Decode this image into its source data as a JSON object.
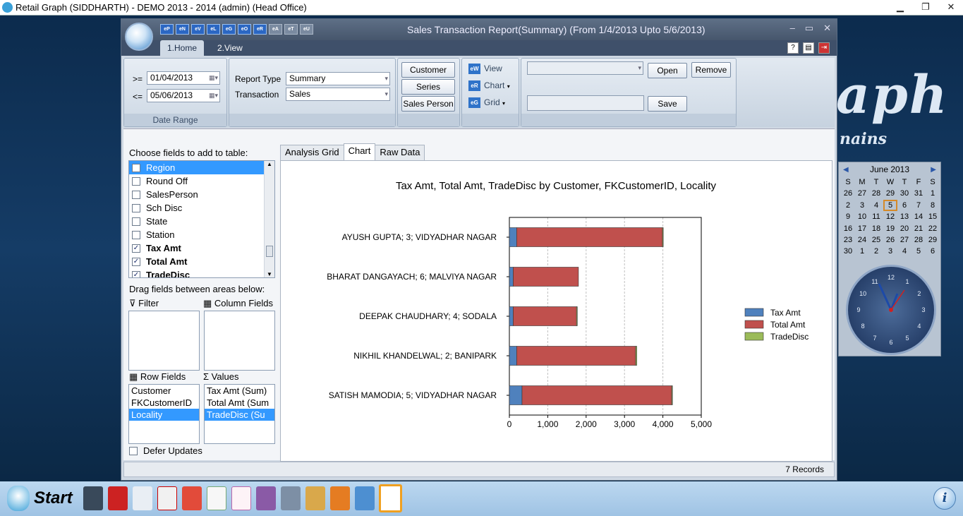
{
  "window": {
    "title": "Retail Graph (SIDDHARTH) - DEMO  2013 - 2014 (admin) (Head Office)"
  },
  "app": {
    "title": "Sales Transaction Report(Summary) (From 1/4/2013 Upto 5/6/2013)",
    "qat_icons": [
      "eP",
      "eN",
      "eV",
      "eL",
      "eG",
      "eO",
      "eR",
      "eA",
      "eT",
      "eU"
    ],
    "tabs": [
      {
        "label": "1.Home"
      },
      {
        "label": "2.View"
      }
    ]
  },
  "ribbon": {
    "date": {
      "from_label": ">=",
      "from_value": "01/04/2013",
      "to_label": "<=",
      "to_value": "05/06/2013",
      "caption": "Date Range"
    },
    "report": {
      "type_label": "Report Type",
      "type_value": "Summary",
      "transaction_label": "Transaction",
      "transaction_value": "Sales"
    },
    "buttons": {
      "customer": "Customer",
      "series": "Series",
      "sales_person": "Sales Person"
    },
    "view": {
      "view": "View",
      "chart": "Chart",
      "grid": "Grid"
    },
    "layout": {
      "open": "Open",
      "remove": "Remove",
      "save": "Save"
    }
  },
  "fields": {
    "title": "Choose fields to add to table:",
    "items": [
      {
        "label": "Region",
        "checked": false,
        "selected": true
      },
      {
        "label": "Round Off",
        "checked": false
      },
      {
        "label": "SalesPerson",
        "checked": false
      },
      {
        "label": "Sch Disc",
        "checked": false
      },
      {
        "label": "State",
        "checked": false
      },
      {
        "label": "Station",
        "checked": false
      },
      {
        "label": "Tax Amt",
        "checked": true
      },
      {
        "label": "Total Amt",
        "checked": true
      },
      {
        "label": "TradeDisc",
        "checked": true
      }
    ],
    "drag_title": "Drag fields between areas below:",
    "filter_label": "Filter",
    "column_label": "Column Fields",
    "row_label": "Row Fields",
    "values_label": "Values",
    "row_fields": [
      "Customer",
      "FKCustomerID",
      "Locality"
    ],
    "values": [
      "Tax Amt (Sum)",
      "Total Amt (Sum",
      "TradeDisc (Su"
    ],
    "defer": "Defer Updates"
  },
  "content_tabs": [
    "Analysis Grid",
    "Chart",
    "Raw Data"
  ],
  "chart_data": {
    "type": "bar",
    "orientation": "horizontal",
    "stacked": true,
    "title": "Tax Amt, Total Amt, TradeDisc by Customer, FKCustomerID, Locality",
    "categories": [
      "AYUSH GUPTA; 3; VIDYADHAR NAGAR",
      "BHARAT DANGAYACH; 6; MALVIYA NAGAR",
      "DEEPAK CHAUDHARY; 4; SODALA",
      "NIKHIL KHANDELWAL; 2; BANIPARK",
      "SATISH MAMODIA; 5; VIDYADHAR NAGAR"
    ],
    "series": [
      {
        "name": "Tax Amt",
        "color": "#4f81bd",
        "values": [
          190,
          100,
          100,
          190,
          330
        ]
      },
      {
        "name": "Total Amt",
        "color": "#c0504d",
        "values": [
          3800,
          1700,
          1650,
          3100,
          3900
        ]
      },
      {
        "name": "TradeDisc",
        "color": "#9bbb59",
        "values": [
          20,
          0,
          20,
          30,
          20
        ]
      }
    ],
    "xlim": [
      0,
      5000
    ],
    "xticks": [
      "0",
      "1,000",
      "2,000",
      "3,000",
      "4,000",
      "5,000"
    ],
    "grid": true,
    "legend": "right"
  },
  "status": {
    "records": "7 Records"
  },
  "calendar": {
    "month": "June  2013",
    "days_header": [
      "S",
      "M",
      "T",
      "W",
      "T",
      "F",
      "S"
    ],
    "days": [
      "26",
      "27",
      "28",
      "29",
      "30",
      "31",
      "1",
      "2",
      "3",
      "4",
      "5",
      "6",
      "7",
      "8",
      "9",
      "10",
      "11",
      "12",
      "13",
      "14",
      "15",
      "16",
      "17",
      "18",
      "19",
      "20",
      "21",
      "22",
      "23",
      "24",
      "25",
      "26",
      "27",
      "28",
      "29",
      "30",
      "1",
      "2",
      "3",
      "4",
      "5",
      "6"
    ],
    "selected": "5",
    "clock_numbers": [
      "12",
      "1",
      "2",
      "3",
      "4",
      "5",
      "6",
      "7",
      "8",
      "9",
      "10",
      "11"
    ]
  },
  "logo": {
    "main": "aph",
    "sub": "nains"
  },
  "taskbar": {
    "start": "Start"
  }
}
